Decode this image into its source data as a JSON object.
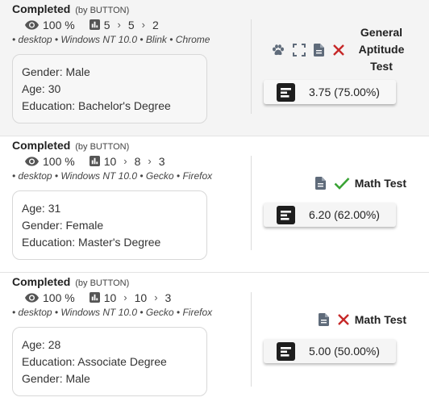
{
  "sessions": [
    {
      "status": "Completed",
      "by": "(by BUTTON)",
      "percent": "100 %",
      "steps": [
        "5",
        "5",
        "2"
      ],
      "env": "• desktop • Windows NT 10.0 • Blink • Chrome",
      "info": [
        "Gender: Male",
        "Age: 30",
        "Education: Bachelor's Degree"
      ],
      "test_icons": [
        "paw-icon",
        "fullscreen-icon",
        "document-icon",
        "cross-icon"
      ],
      "test_name_lines": [
        "General",
        "Aptitude",
        "Test"
      ],
      "score": "3.75 (75.00%)"
    },
    {
      "status": "Completed",
      "by": "(by BUTTON)",
      "percent": "100 %",
      "steps": [
        "10",
        "8",
        "3"
      ],
      "env": "• desktop • Windows NT 10.0 • Gecko • Firefox",
      "info": [
        "Age: 31",
        "Gender: Female",
        "Education: Master's Degree"
      ],
      "test_icons": [
        "document-icon",
        "check-icon"
      ],
      "test_name": "Math Test",
      "score": "6.20 (62.00%)"
    },
    {
      "status": "Completed",
      "by": "(by BUTTON)",
      "percent": "100 %",
      "steps": [
        "10",
        "10",
        "3"
      ],
      "env": "• desktop • Windows NT 10.0 • Gecko • Firefox",
      "info": [
        "Age: 28",
        "Education: Associate Degree",
        "Gender: Male"
      ],
      "test_icons": [
        "document-icon",
        "cross-icon"
      ],
      "test_name": "Math Test",
      "score": "5.00 (50.00%)"
    }
  ],
  "colors": {
    "check": "#3aa335",
    "cross": "#c62828",
    "icon": "#5f6b7a",
    "odd_row": "#f4f4f4"
  }
}
